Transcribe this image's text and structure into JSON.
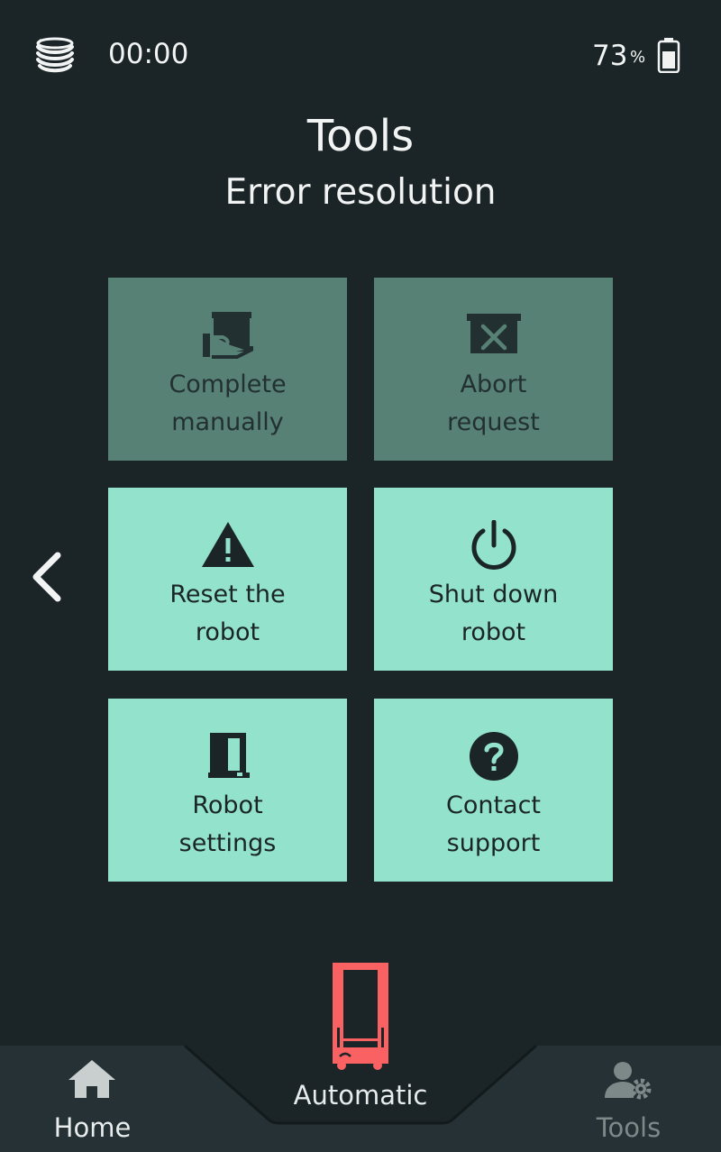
{
  "status": {
    "logo_icon": "stacked-layers-logo",
    "time": "00:00",
    "battery_percent": "73",
    "battery_unit": "%",
    "battery_icon": "battery-icon"
  },
  "header": {
    "title": "Tools",
    "subtitle": "Error resolution"
  },
  "navigation": {
    "back_icon": "chevron-left-icon"
  },
  "tiles": [
    {
      "label": "Complete\nmanually",
      "icon": "hand-holding-box-icon",
      "enabled": false
    },
    {
      "label": "Abort\nrequest",
      "icon": "box-cross-icon",
      "enabled": false
    },
    {
      "label": "Reset the\nrobot",
      "icon": "warning-icon",
      "enabled": true
    },
    {
      "label": "Shut down\nrobot",
      "icon": "power-icon",
      "enabled": true
    },
    {
      "label": "Robot\nsettings",
      "icon": "robot-frame-icon",
      "enabled": true
    },
    {
      "label": "Contact\nsupport",
      "icon": "question-circle-icon",
      "enabled": true
    }
  ],
  "bottom_nav": {
    "home_label": "Home",
    "mode_label": "Automatic",
    "tools_label": "Tools"
  },
  "colors": {
    "background": "#1b2528",
    "tile_enabled": "#93e3cc",
    "tile_disabled": "#568174",
    "robot_status": "#fa6163",
    "nav_bar": "#253135"
  }
}
